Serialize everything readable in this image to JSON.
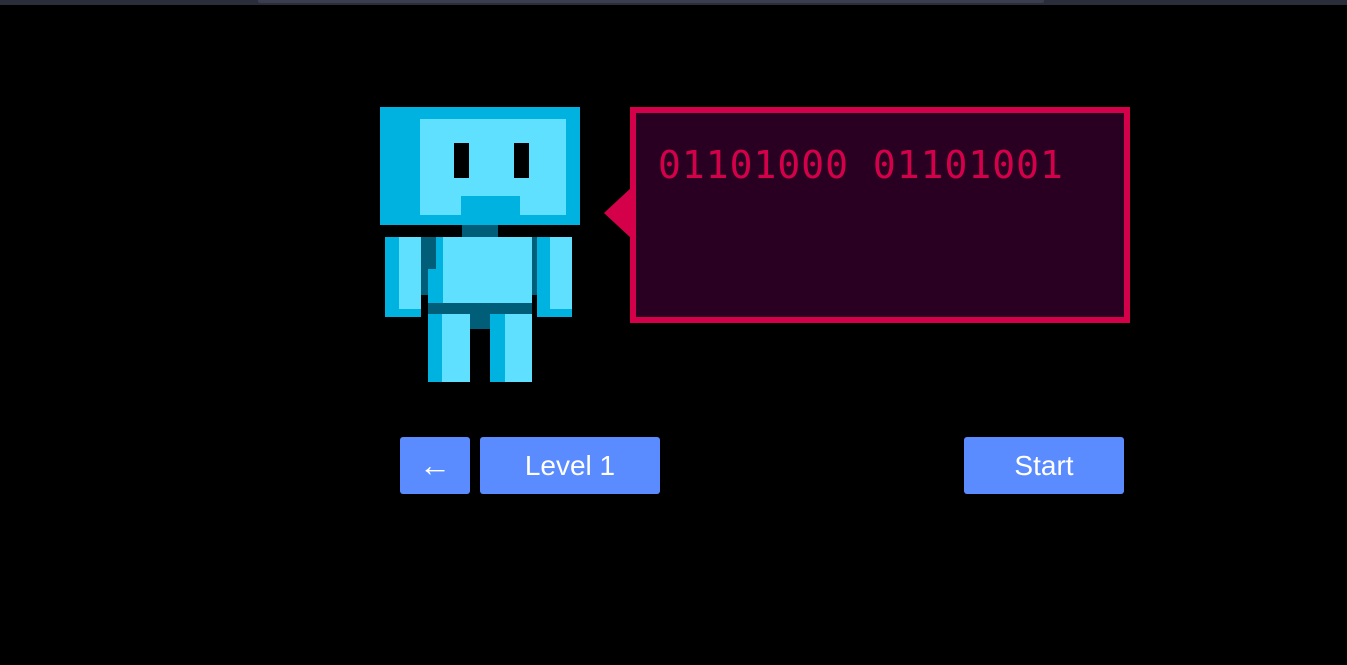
{
  "speech": {
    "text": "01101000 01101001"
  },
  "controls": {
    "back_label": "←",
    "level_label": "Level 1",
    "start_label": "Start"
  },
  "colors": {
    "background": "#000000",
    "robot_light": "#5fe0ff",
    "robot_mid": "#00b2e0",
    "robot_dark": "#005e78",
    "bubble_border": "#d4004a",
    "bubble_fill": "#2a0022",
    "button": "#5b8cff"
  },
  "icons": {
    "back": "left-arrow-icon"
  }
}
